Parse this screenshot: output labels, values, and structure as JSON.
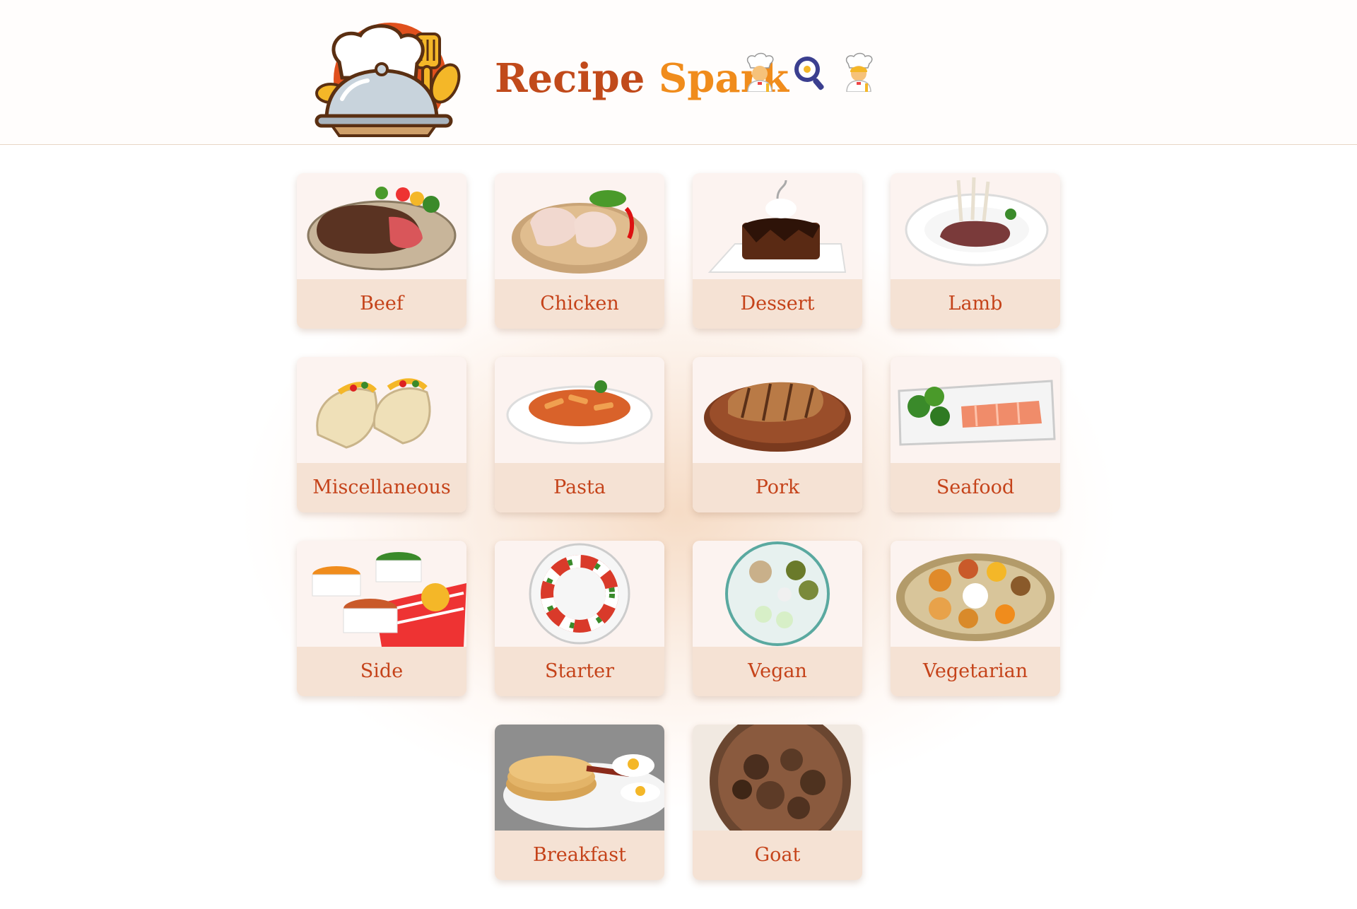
{
  "app": {
    "title_part1": "Recipe",
    "title_part2": "Spark",
    "header_icons": [
      "man-cook-icon",
      "frying-pan-egg-icon",
      "woman-cook-icon"
    ]
  },
  "colors": {
    "brand_dark": "#c14a1b",
    "brand_orange": "#f08c1c",
    "label_text": "#c5431a",
    "label_bg": "#f5e2d4"
  },
  "categories": [
    {
      "label": "Beef",
      "icon": "beef-steak-image"
    },
    {
      "label": "Chicken",
      "icon": "chicken-legs-image"
    },
    {
      "label": "Dessert",
      "icon": "chocolate-cake-image"
    },
    {
      "label": "Lamb",
      "icon": "lamb-chops-image"
    },
    {
      "label": "Miscellaneous",
      "icon": "tacos-image"
    },
    {
      "label": "Pasta",
      "icon": "penne-pasta-image"
    },
    {
      "label": "Pork",
      "icon": "pork-chop-image"
    },
    {
      "label": "Seafood",
      "icon": "salmon-platter-image"
    },
    {
      "label": "Side",
      "icon": "side-dishes-image"
    },
    {
      "label": "Starter",
      "icon": "caprese-salad-image"
    },
    {
      "label": "Vegan",
      "icon": "vegan-bowl-image"
    },
    {
      "label": "Vegetarian",
      "icon": "thali-platter-image"
    },
    {
      "label": "Breakfast",
      "icon": "pancakes-eggs-image"
    },
    {
      "label": "Goat",
      "icon": "goat-curry-image"
    }
  ]
}
